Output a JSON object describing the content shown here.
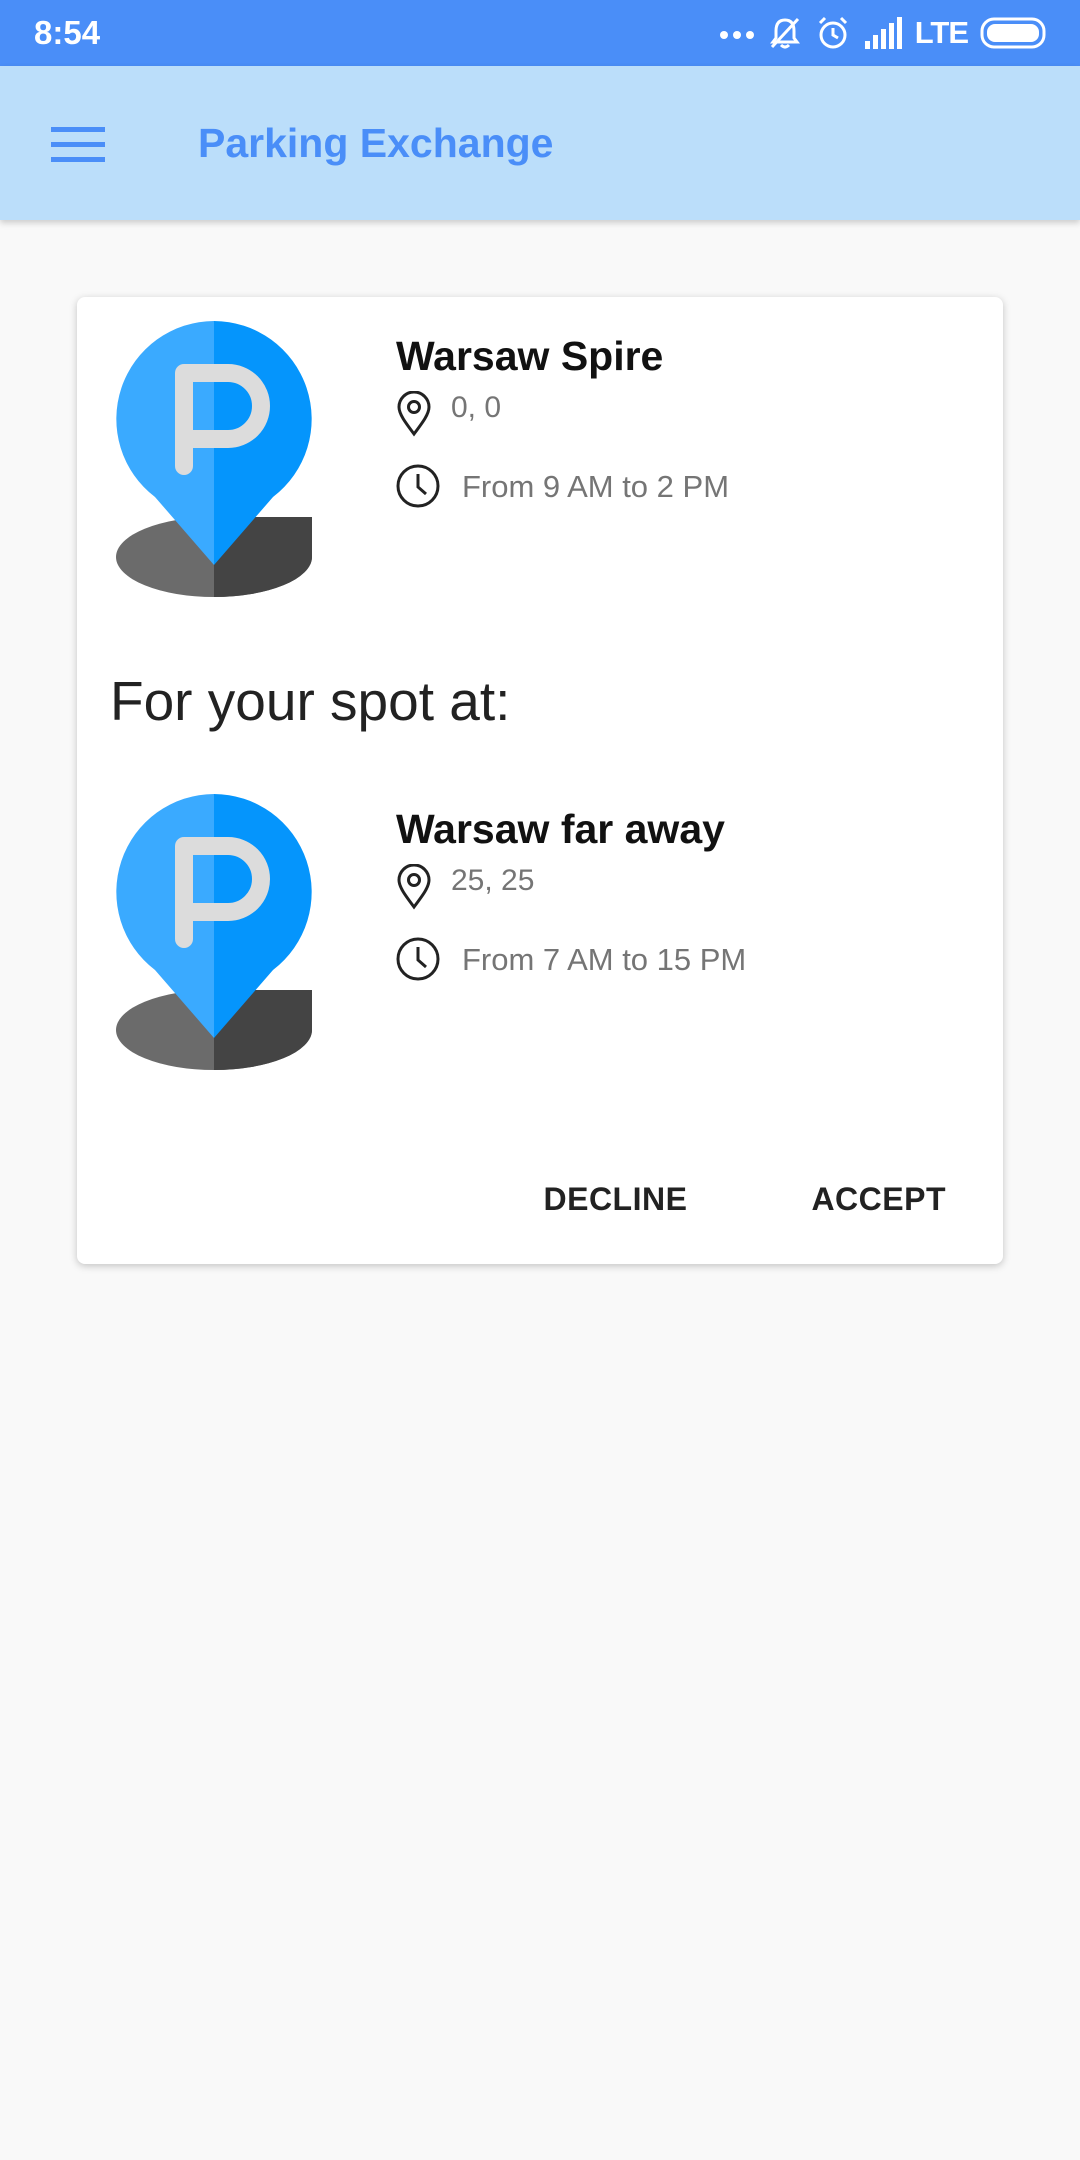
{
  "status_bar": {
    "time": "8:54",
    "network": "LTE"
  },
  "app_bar": {
    "title": "Parking Exchange",
    "menu_icon": "hamburger-menu-icon"
  },
  "offer": {
    "offered_spot": {
      "name": "Warsaw Spire",
      "coords": "0, 0",
      "time": "From 9 AM to 2 PM"
    },
    "section_label": "For your spot at:",
    "your_spot": {
      "name": "Warsaw far away",
      "coords": "25, 25",
      "time": "From 7 AM to 15 PM"
    },
    "actions": {
      "decline": "DECLINE",
      "accept": "ACCEPT"
    }
  },
  "colors": {
    "status_bar": "#4a8ef8",
    "app_bar": "#bbdefa",
    "accent": "#4a8ef8",
    "pin_blue": "#0595fc",
    "pin_blue_light": "#3aaaff",
    "shadow_light": "#6b6b6b",
    "shadow_dark": "#444444"
  }
}
